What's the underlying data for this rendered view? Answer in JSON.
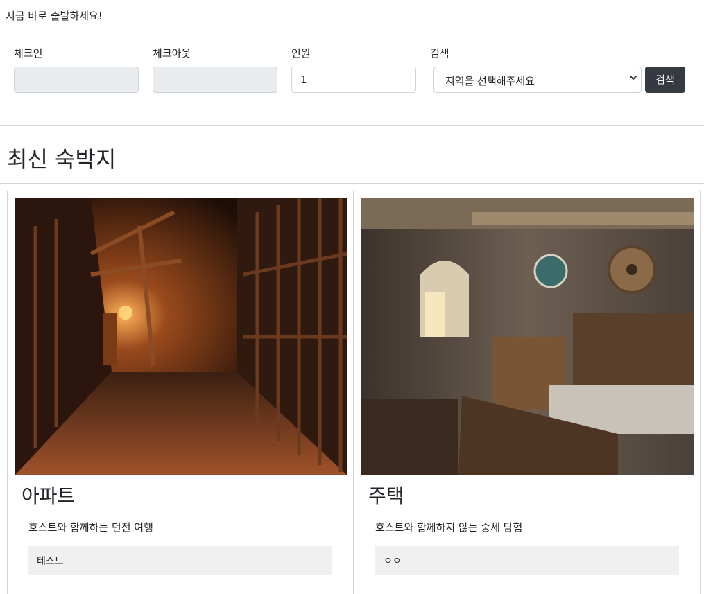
{
  "top_banner": "지금 바로 출발하세요!",
  "search": {
    "checkin_label": "체크인",
    "checkout_label": "체크아웃",
    "guests_label": "인원",
    "guests_value": "1",
    "region_label": "검색",
    "region_selected": "지역을 선택해주세요",
    "search_button": "검색"
  },
  "section": {
    "title": "최신 숙박지"
  },
  "listings": [
    {
      "title": "아파트",
      "description": "호스트와 함께하는 던전 여행",
      "tag": "테스트",
      "image": "dungeon-corridor-photo"
    },
    {
      "title": "주택",
      "description": "호스트와 함께하지 않는 중세 탐험",
      "tag": "ㅇㅇ",
      "image": "medieval-bedroom-photo"
    }
  ],
  "colors": {
    "button_dark": "#343a40",
    "disabled_input": "#e9ecef",
    "tag_bg": "#f0f0f0"
  }
}
